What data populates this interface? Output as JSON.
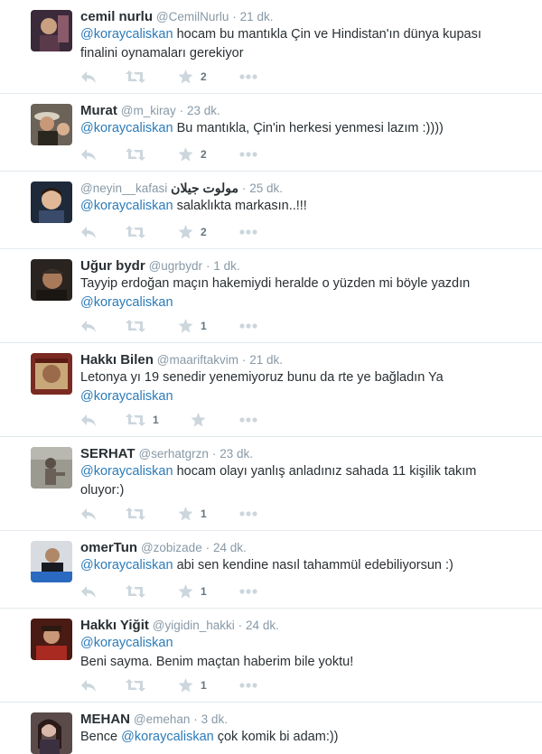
{
  "colors": {
    "mention": "#2b7bb9",
    "icon": "#ccd6dd",
    "meta": "#8899a6",
    "divider": "#e1e8ed"
  },
  "tweets": [
    {
      "fullname": "cemil nurlu",
      "screen_name": "@CemilNurlu",
      "dot": "·",
      "time": "21 dk.",
      "mention": "@koraycaliskan",
      "text": " hocam bu mantıkla Çin ve Hindistan'ın dünya kupası finalini oynamaları  gerekiyor",
      "favorite_count": "2",
      "retweet_count": ""
    },
    {
      "fullname": "Murat",
      "screen_name": "@m_kiray",
      "dot": "·",
      "time": "23 dk.",
      "mention": "@koraycaliskan",
      "text": " Bu mantıkla, Çin'in herkesi yenmesi lazım :))))",
      "favorite_count": "2",
      "retweet_count": ""
    },
    {
      "fullname": "مولوت جيلان",
      "screen_name": "@neyin__kafasi",
      "dot": "·",
      "time": "25 dk.",
      "mention": "@koraycaliskan",
      "text": " salaklıkta markasın..!!!",
      "favorite_count": "2",
      "retweet_count": ""
    },
    {
      "fullname": "Uğur bydr",
      "screen_name": "@ugrbydr",
      "dot": "·",
      "time": "1 dk.",
      "text": "Tayyip erdoğan maçın hakemiydi heralde o yüzden mi böyle yazdın ",
      "mention": "@koraycaliskan",
      "favorite_count": "1",
      "retweet_count": ""
    },
    {
      "fullname": "Hakkı Bilen",
      "screen_name": "@maariftakvim",
      "dot": "·",
      "time": "21 dk.",
      "text": "Letonya yı 19 senedir yenemiyoruz bunu da rte ye bağladın Ya ",
      "mention": "@koraycaliskan",
      "favorite_count": "",
      "retweet_count": "1"
    },
    {
      "fullname": "SERHAT",
      "screen_name": "@serhatgrzn",
      "dot": "·",
      "time": "23 dk.",
      "mention": "@koraycaliskan",
      "text": " hocam olayı yanlış anladınız sahada 11 kişilik takım oluyor:)",
      "favorite_count": "1",
      "retweet_count": ""
    },
    {
      "fullname": "omerTun",
      "screen_name": "@zobizade",
      "dot": "·",
      "time": "24 dk.",
      "mention": "@koraycaliskan",
      "text": " abi sen kendine nasıl tahammül edebiliyorsun :)",
      "favorite_count": "1",
      "retweet_count": ""
    },
    {
      "fullname": "Hakkı Yiğit",
      "screen_name": "@yigidin_hakki",
      "dot": "·",
      "time": "24 dk.",
      "mention": "@koraycaliskan",
      "text": "Beni sayma. Benim maçtan haberim bile yoktu!",
      "favorite_count": "1",
      "retweet_count": ""
    },
    {
      "fullname": "MEHAN",
      "screen_name": "@emehan",
      "dot": "·",
      "time": "3 dk.",
      "text_before": "Bence ",
      "mention": "@koraycaliskan",
      "text": " çok komik bi adam:))"
    }
  ]
}
